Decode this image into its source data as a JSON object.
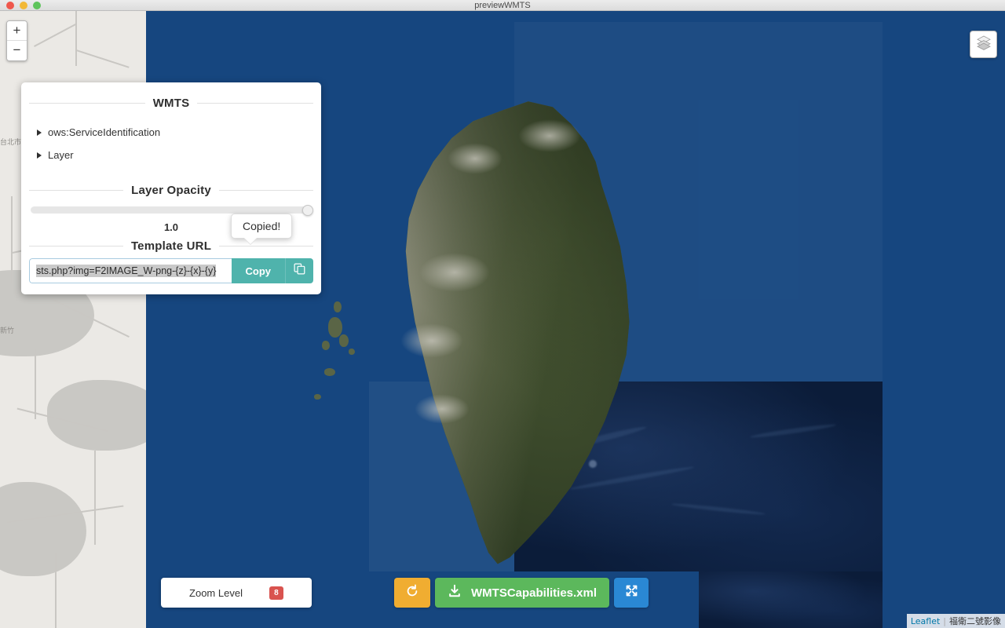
{
  "window": {
    "title": "previewWMTS",
    "traffic_lights": [
      "close",
      "minimize",
      "zoom"
    ]
  },
  "map": {
    "zoom_in_label": "+",
    "zoom_out_label": "−",
    "layers_icon": "layers-stack-icon",
    "ocean_color": "#16467f",
    "bathymetry_color": "#0b1c39",
    "basemap_labels": [
      "台北市",
      "新竹"
    ],
    "attribution": {
      "leaflet": "Leaflet",
      "separator": "|",
      "source": "福衛二號影像"
    }
  },
  "panel": {
    "title": "WMTS",
    "tree": [
      {
        "label": "ows:ServiceIdentification",
        "expanded": false
      },
      {
        "label": "Layer",
        "expanded": false
      }
    ],
    "opacity": {
      "title": "Layer Opacity",
      "value": "1.0",
      "slider_position_percent": 100
    },
    "template_url": {
      "title": "Template URL",
      "value": "sts.php?img=F2IMAGE_W-png-{z}-{x}-{y}",
      "selected": true,
      "copy_label": "Copy",
      "copy_icon": "copy-icon",
      "accent_color": "#4fb3ac"
    },
    "tooltip": {
      "text": "Copied!"
    }
  },
  "bottom": {
    "zoom_level": {
      "label": "Zoom Level",
      "value": "8",
      "badge_color": "#d9534f"
    },
    "reset_button": {
      "icon": "reset-arrow-icon",
      "color": "#f0ad31"
    },
    "download_button": {
      "icon": "download-icon",
      "label": "WMTSCapabilities.xml",
      "color": "#5cb85c"
    },
    "fullscreen_button": {
      "icon": "expand-arrows-icon",
      "color": "#2a88d4"
    }
  }
}
